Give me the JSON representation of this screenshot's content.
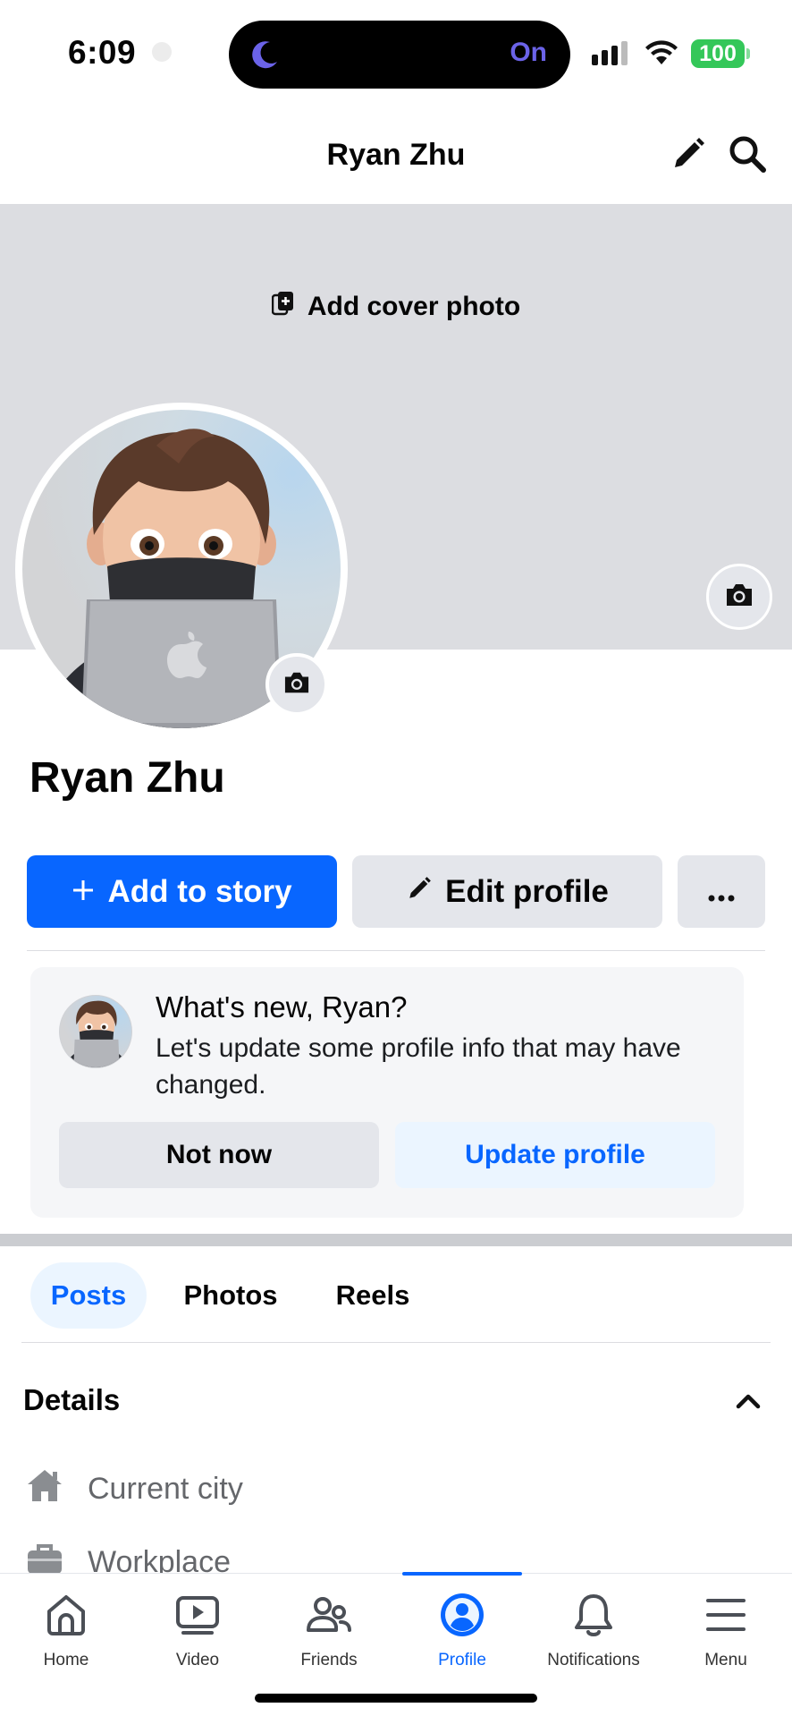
{
  "status_bar": {
    "time": "6:09",
    "focus_label": "On",
    "battery": "100"
  },
  "header": {
    "title": "Ryan Zhu"
  },
  "cover": {
    "add_cover_label": "Add cover photo"
  },
  "profile": {
    "name": "Ryan Zhu"
  },
  "actions": {
    "add_story_label": "Add to story",
    "edit_profile_label": "Edit profile",
    "more_label": "···"
  },
  "prompt_card": {
    "title": "What's new, Ryan?",
    "text": "Let's update some profile info that may have changed.",
    "not_now_label": "Not now",
    "update_label": "Update profile"
  },
  "tabs": [
    {
      "label": "Posts",
      "active": true
    },
    {
      "label": "Photos",
      "active": false
    },
    {
      "label": "Reels",
      "active": false
    }
  ],
  "details": {
    "title": "Details",
    "items": [
      {
        "label": "Current city",
        "icon": "home-icon"
      },
      {
        "label": "Workplace",
        "icon": "briefcase-icon"
      }
    ]
  },
  "bottom_nav": [
    {
      "label": "Home",
      "icon": "home-icon",
      "active": false
    },
    {
      "label": "Video",
      "icon": "video-icon",
      "active": false
    },
    {
      "label": "Friends",
      "icon": "friends-icon",
      "active": false
    },
    {
      "label": "Profile",
      "icon": "profile-icon",
      "active": true
    },
    {
      "label": "Notifications",
      "icon": "bell-icon",
      "active": false
    },
    {
      "label": "Menu",
      "icon": "menu-icon",
      "active": false
    }
  ],
  "colors": {
    "accent": "#0866ff",
    "accent_light": "#ebf5ff",
    "button_gray": "#e4e6eb",
    "cover_gray": "#dcdde1"
  }
}
